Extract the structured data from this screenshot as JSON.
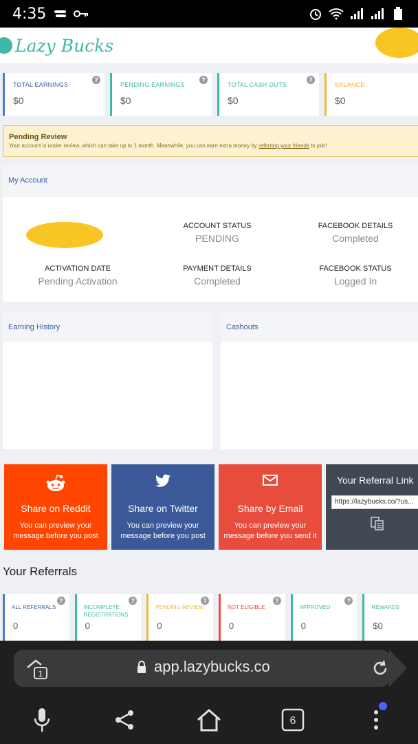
{
  "status_bar": {
    "time": "4:35"
  },
  "app": {
    "brand": "Lazy Bucks"
  },
  "stats": [
    {
      "label": "TOTAL EARNINGS",
      "value": "$0",
      "color": "#4a7bd0"
    },
    {
      "label": "PENDING EARNINGS",
      "value": "$0",
      "color": "#3fb9a7"
    },
    {
      "label": "TOTAL CASH OUTS",
      "value": "$0",
      "color": "#3fb9a7"
    },
    {
      "label": "BALANCE",
      "value": "$0",
      "color": "#f0b73a"
    }
  ],
  "pending_review": {
    "title": "Pending Review",
    "message": "Your account is under review, which can take up to 1 month. Meanwhile, you can earn extra money by",
    "link": "referring your friends",
    "suffix": "to join!"
  },
  "account": {
    "title": "My Account",
    "account_status": {
      "label": "ACCOUNT STATUS",
      "value": "PENDING"
    },
    "facebook_details": {
      "label": "FACEBOOK DETAILS",
      "value": "Completed"
    },
    "activation_date": {
      "label": "ACTIVATION DATE",
      "value": "Pending Activation"
    },
    "payment_details": {
      "label": "PAYMENT DETAILS",
      "value": "Completed"
    },
    "facebook_status": {
      "label": "FACEBOOK STATUS",
      "value": "Logged In"
    }
  },
  "panels": {
    "earning_history": "Earning History",
    "cashouts": "Cashouts"
  },
  "share": {
    "reddit": {
      "title": "Share on Reddit",
      "sub": "You can preview your message before you post",
      "color": "#ff4500"
    },
    "twitter": {
      "title": "Share on Twitter",
      "sub": "You can preview your message before you post",
      "color": "#3b5998"
    },
    "email": {
      "title": "Share by Email",
      "sub": "You can preview your message before you send it",
      "color": "#e74c3c"
    },
    "referral": {
      "title": "Your Referral Link",
      "url": "https://lazybucks.co/?us..."
    }
  },
  "referrals": {
    "heading": "Your Referrals",
    "items": [
      {
        "label": "ALL REFERRALS",
        "value": "0",
        "color": "#4a7bd0"
      },
      {
        "label": "INCOMPLETE REGISTRATIONS",
        "value": "0",
        "color": "#3fb9a7"
      },
      {
        "label": "PENDING REVIEW",
        "value": "0",
        "color": "#f0b73a"
      },
      {
        "label": "NOT ELIGIBLE",
        "value": "0",
        "color": "#e74c3c"
      },
      {
        "label": "APPROVED",
        "value": "0",
        "color": "#3fb9a7"
      },
      {
        "label": "REWARDS",
        "value": "$0",
        "color": "#3fb9a7"
      }
    ]
  },
  "browser": {
    "url": "app.lazybucks.co",
    "tab_count": "6",
    "tab_badge": "1"
  }
}
